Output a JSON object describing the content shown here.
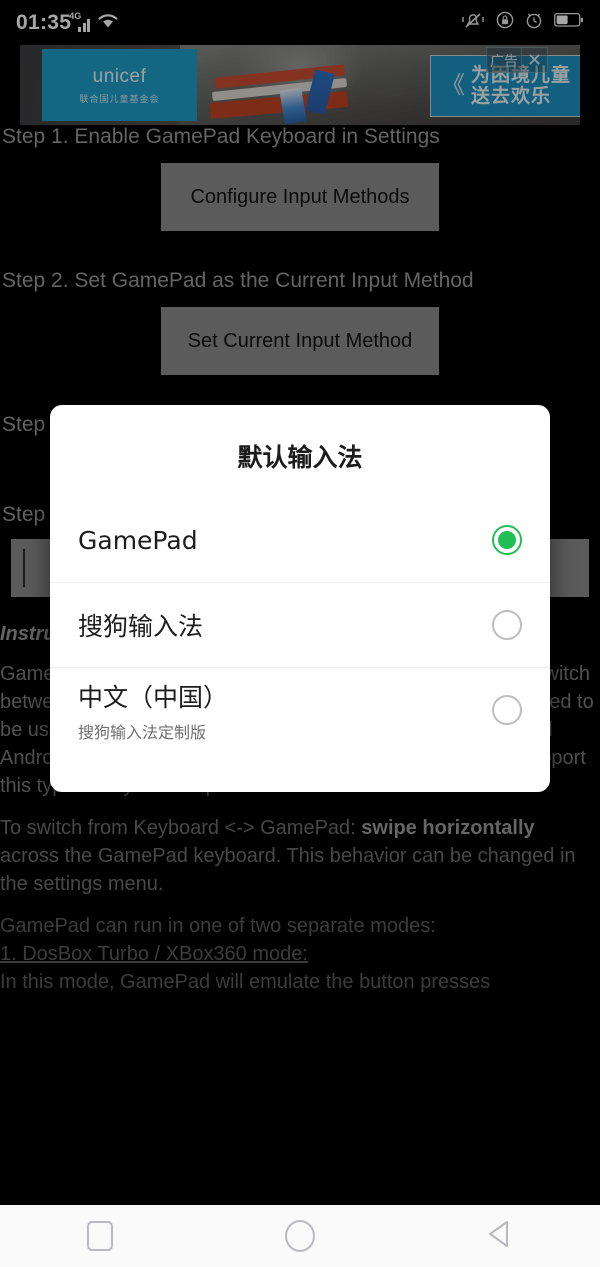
{
  "status_bar": {
    "time": "01:35",
    "network_label": "4G",
    "icons": [
      "signal-bars-icon",
      "wifi-icon",
      "vibrate-icon",
      "lock-icon",
      "alarm-icon",
      "battery-icon"
    ]
  },
  "ad": {
    "brand": "unicef",
    "brand_sub": "联合国儿童基金会",
    "sign_chevron": "《",
    "sign_line1": "为困境儿童",
    "sign_line2": "送去欢乐",
    "tag_label": "广告",
    "close_label": "✕"
  },
  "main": {
    "step1_text": "Step 1. Enable GamePad Keyboard in Settings",
    "step1_button": "Configure Input Methods",
    "step2_text": "Step 2. Set GamePad as the Current Input Method",
    "step2_button": "Set Current Input Method",
    "step3_text": "Step",
    "step4_text": "Step",
    "input_value": "",
    "instructions_heading": "Instructions",
    "para1": "Gamepad Keyboard is a Virtual Keyboard that allows you to switch between a virtual keyboard and a virtual gamepad. It is designed to be used with games and applications that can accept standard Android Keyboard Input Methods. Most Android emulators support this type of keyboard input.",
    "para2_prefix": "To switch from Keyboard <-> GamePad: ",
    "para2_bold": "swipe horizontally",
    "para2_suffix": " across the GamePad keyboard. This behavior can be changed in the settings menu.",
    "para3_line1": "GamePad can run in one of two separate modes:",
    "para3_line2": "1. DosBox Turbo / XBox360 mode:",
    "para3_line3": "In this mode, GamePad will emulate the button presses"
  },
  "dialog": {
    "title": "默认输入法",
    "options": [
      {
        "label": "GamePad",
        "subtitle": "",
        "selected": true
      },
      {
        "label": "搜狗输入法",
        "subtitle": "",
        "selected": false
      },
      {
        "label": "中文（中国）",
        "subtitle": "搜狗输入法定制版",
        "selected": false
      }
    ]
  },
  "navbar": {
    "recents_label": "recent-apps",
    "home_label": "home",
    "back_label": "back"
  },
  "colors": {
    "accent_green": "#20bf55",
    "ad_blue": "#1f9ec9",
    "button_grey": "#8d8d8d",
    "dialog_bg": "#ffffff",
    "screen_bg": "#000000"
  }
}
